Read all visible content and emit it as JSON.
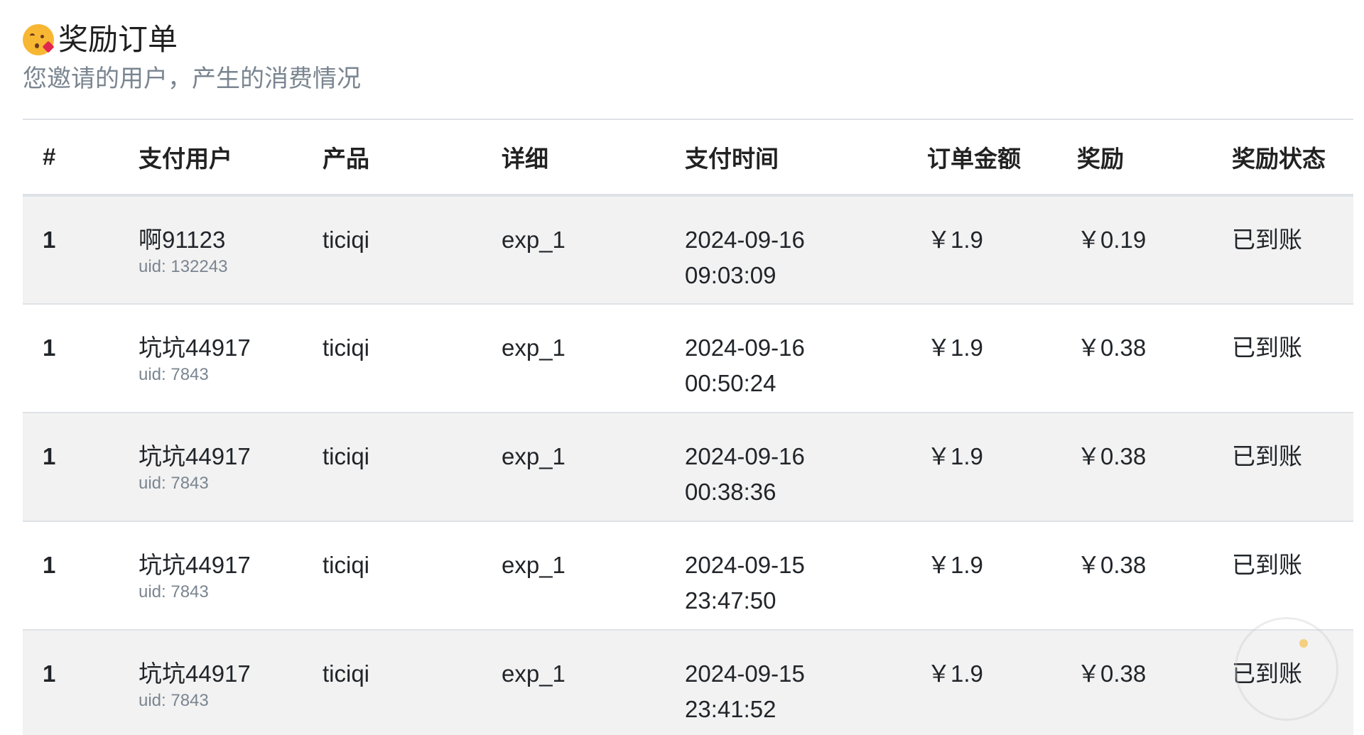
{
  "header": {
    "title": "奖励订单",
    "subtitle": "您邀请的用户，产生的消费情况",
    "title_icon": "kissing-heart-emoji"
  },
  "table": {
    "columns": [
      "#",
      "支付用户",
      "产品",
      "详细",
      "支付时间",
      "订单金额",
      "奖励",
      "奖励状态"
    ],
    "rows": [
      {
        "idx": "1",
        "user": "啊91123",
        "uid": "uid: 132243",
        "product": "ticiqi",
        "detail": "exp_1",
        "date": "2024-09-16",
        "time": "09:03:09",
        "amount": "￥1.9",
        "reward": "￥0.19",
        "status": "已到账"
      },
      {
        "idx": "1",
        "user": "坑坑44917",
        "uid": "uid: 7843",
        "product": "ticiqi",
        "detail": "exp_1",
        "date": "2024-09-16",
        "time": "00:50:24",
        "amount": "￥1.9",
        "reward": "￥0.38",
        "status": "已到账"
      },
      {
        "idx": "1",
        "user": "坑坑44917",
        "uid": "uid: 7843",
        "product": "ticiqi",
        "detail": "exp_1",
        "date": "2024-09-16",
        "time": "00:38:36",
        "amount": "￥1.9",
        "reward": "￥0.38",
        "status": "已到账"
      },
      {
        "idx": "1",
        "user": "坑坑44917",
        "uid": "uid: 7843",
        "product": "ticiqi",
        "detail": "exp_1",
        "date": "2024-09-15",
        "time": "23:47:50",
        "amount": "￥1.9",
        "reward": "￥0.38",
        "status": "已到账"
      },
      {
        "idx": "1",
        "user": "坑坑44917",
        "uid": "uid: 7843",
        "product": "ticiqi",
        "detail": "exp_1",
        "date": "2024-09-15",
        "time": "23:41:52",
        "amount": "￥1.9",
        "reward": "￥0.38",
        "status": "已到账"
      }
    ]
  },
  "colors": {
    "stripe": "#f2f2f2",
    "border": "#dee2e6",
    "muted_text": "#7a8590"
  }
}
